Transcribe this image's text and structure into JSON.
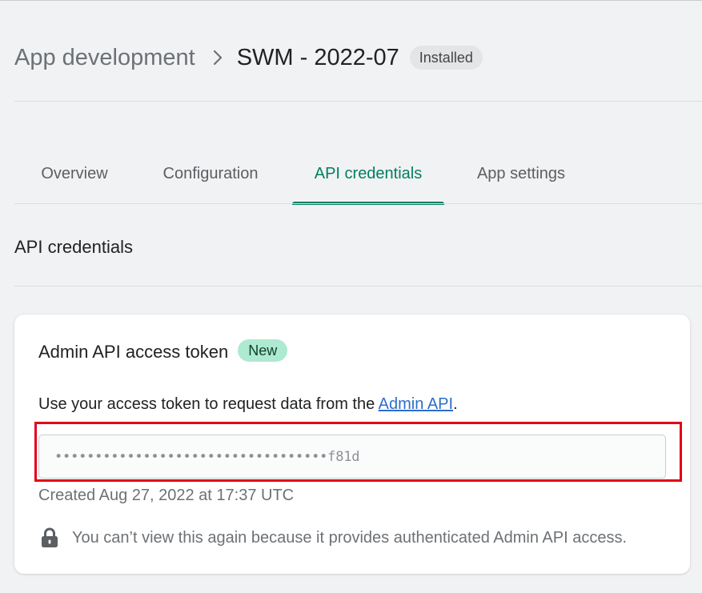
{
  "breadcrumb": {
    "parent": "App development",
    "separator_icon": "chevron-right-icon"
  },
  "page": {
    "title": "SWM - 2022-07",
    "status": "Installed"
  },
  "tabs": [
    {
      "label": "Overview",
      "active": false
    },
    {
      "label": "Configuration",
      "active": false
    },
    {
      "label": "API credentials",
      "active": true
    },
    {
      "label": "App settings",
      "active": false
    }
  ],
  "section": {
    "title": "API credentials"
  },
  "card": {
    "title": "Admin API access token",
    "badge": "New",
    "description_prefix": "Use your access token to request data from the ",
    "description_link": "Admin API",
    "description_suffix": ".",
    "token_value": "••••••••••••••••••••••••••••••••••f81d",
    "created": "Created Aug 27, 2022 at 17:37 UTC",
    "notice_icon": "lock-icon",
    "notice": "You can’t view this again because it provides authenticated Admin API access."
  },
  "colors": {
    "accent": "#008060",
    "link": "#2c6ecb",
    "highlight": "#e2001a",
    "new_badge": "#aee9d1"
  }
}
